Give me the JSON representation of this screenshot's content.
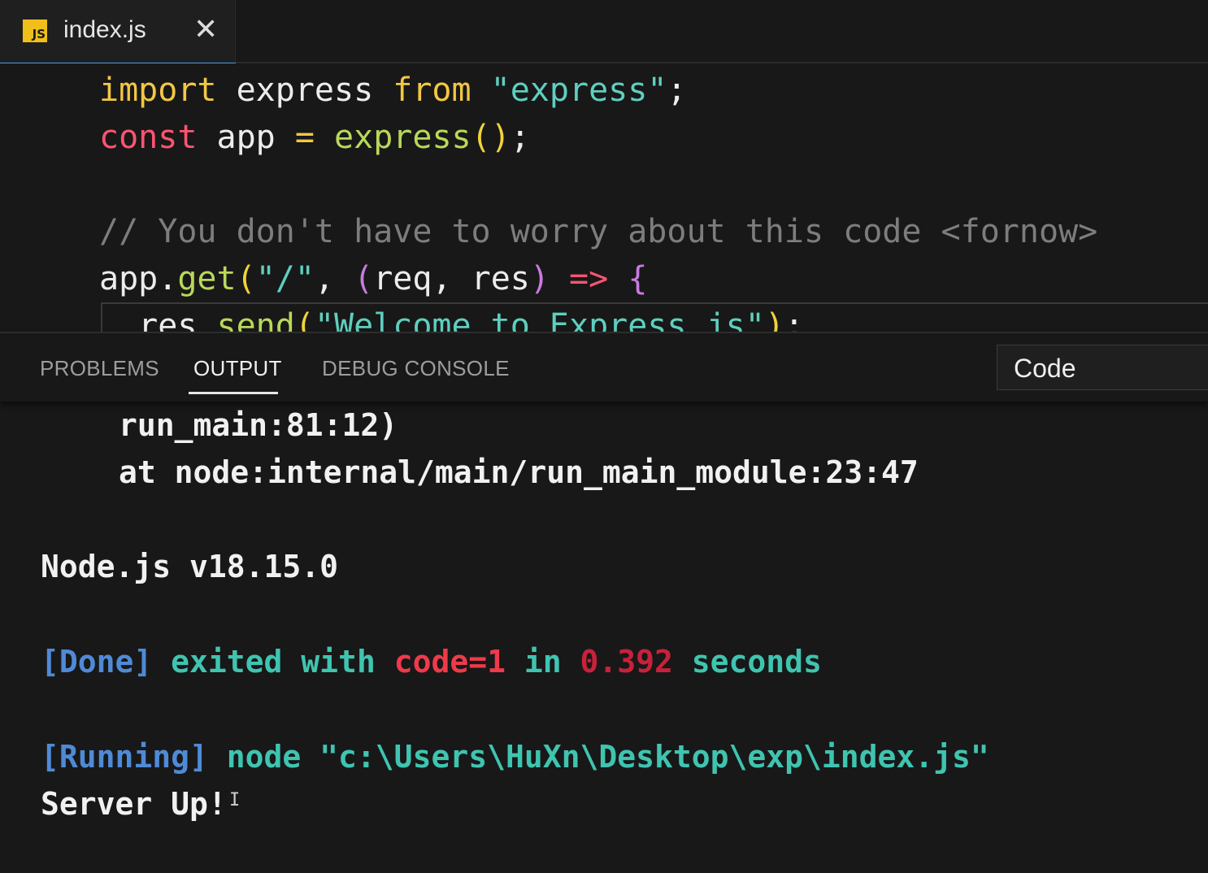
{
  "tab": {
    "icon_label": "JS",
    "title": "index.js",
    "close_glyph": "✕"
  },
  "editor": {
    "line1": {
      "kw_import": "import",
      "ident": " express ",
      "kw_from": "from",
      "sp": " ",
      "str": "\"express\"",
      "semi": ";"
    },
    "line2": {
      "kw_const": "const",
      "ident": " app ",
      "eq": "=",
      "sp": " ",
      "fn": "express",
      "parens": "()",
      "semi": ";"
    },
    "line4": {
      "comment": "// You don't have to worry about this code <fornow>"
    },
    "line5": {
      "obj": "app",
      "dot": ".",
      "fn": "get",
      "open": "(",
      "str": "\"/\"",
      "comma": ", ",
      "popen": "(",
      "params": "req, res",
      "pclose": ")",
      "sp": " ",
      "arrow": "=>",
      "sp2": " ",
      "brace": "{"
    },
    "line6": {
      "indent": "  ",
      "obj": "res",
      "dot": ".",
      "fn": "send",
      "open": "(",
      "str": "\"Welcome to Express.js\"",
      "close": ")",
      "semi": ";"
    }
  },
  "panel": {
    "tabs": [
      "PROBLEMS",
      "OUTPUT",
      "DEBUG CONSOLE"
    ],
    "active_tab": "OUTPUT",
    "output_channel": "Code"
  },
  "output": {
    "line1": "run_main:81:12)",
    "line2": "at node:internal/main/run_main_module:23:47",
    "line3": "Node.js v18.15.0",
    "done": {
      "tag": "[Done]",
      "text1": " exited with ",
      "code": "code=1",
      "text2": " in ",
      "time": "0.392",
      "text3": " seconds"
    },
    "running": {
      "tag": "[Running]",
      "cmd": " node \"c:\\Users\\HuXn\\Desktop\\exp\\index.js\""
    },
    "line_server": "Server Up!"
  },
  "colors": {
    "background": "#181818",
    "tab_accent": "#4d9de0",
    "js_icon": "#f1bf1a",
    "keyword": "#f2c744",
    "string": "#5fcfbf",
    "done_tag": "#4f8ad6",
    "output_teal": "#3fc4b0",
    "error_red": "#ef3a4a"
  }
}
